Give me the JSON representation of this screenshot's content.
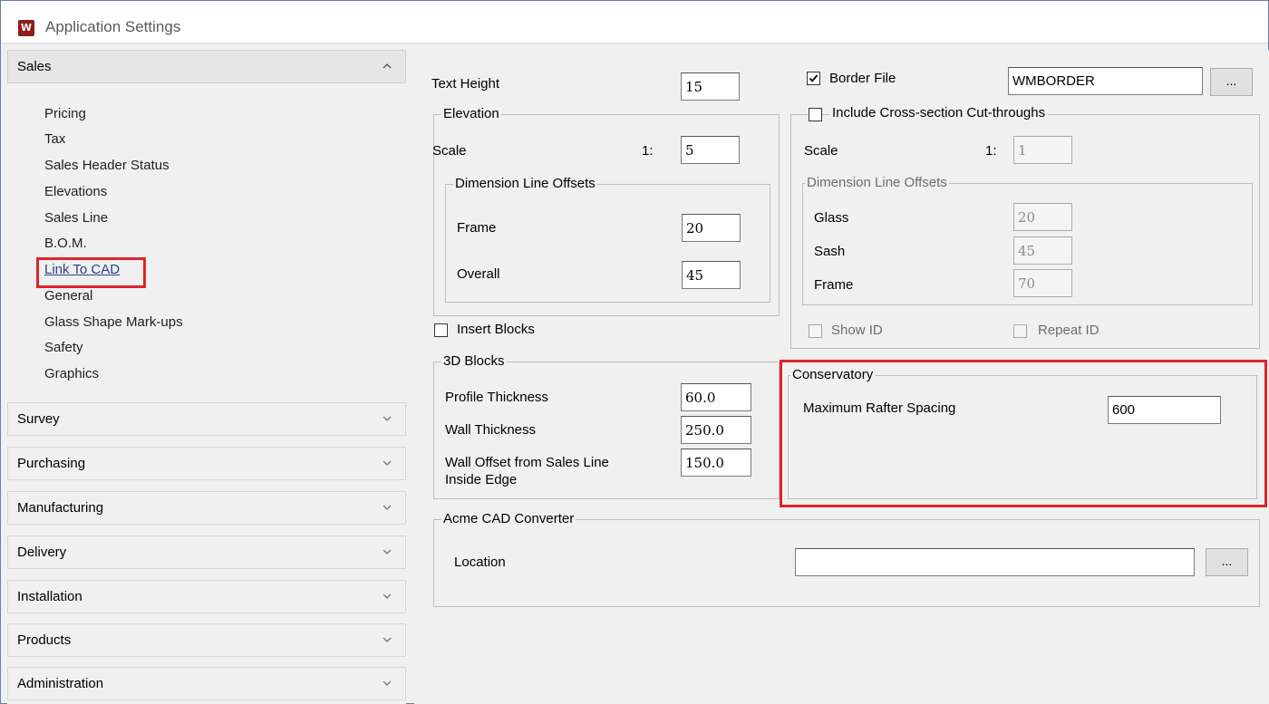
{
  "window": {
    "title": "Application Settings",
    "logo_letter": "W",
    "highlight_color": "#e0242a"
  },
  "sidebar": {
    "groups": [
      {
        "label": "Sales",
        "expanded": true,
        "icon": "chevron-up-icon"
      },
      {
        "label": "Survey",
        "expanded": false,
        "icon": "chevron-down-icon"
      },
      {
        "label": "Purchasing",
        "expanded": false,
        "icon": "chevron-down-icon"
      },
      {
        "label": "Manufacturing",
        "expanded": false,
        "icon": "chevron-down-icon"
      },
      {
        "label": "Delivery",
        "expanded": false,
        "icon": "chevron-down-icon"
      },
      {
        "label": "Installation",
        "expanded": false,
        "icon": "chevron-down-icon"
      },
      {
        "label": "Products",
        "expanded": false,
        "icon": "chevron-down-icon"
      },
      {
        "label": "Administration",
        "expanded": false,
        "icon": "chevron-down-icon"
      }
    ],
    "sales_items": [
      "Pricing",
      "Tax",
      "Sales Header Status",
      "Elevations",
      "Sales Line",
      "B.O.M.",
      "Link To CAD",
      "General",
      "Glass Shape Mark-ups",
      "Safety",
      "Graphics"
    ],
    "selected_item": "Link To CAD"
  },
  "main": {
    "text_height": {
      "label": "Text Height",
      "value": "15"
    },
    "elevation": {
      "legend": "Elevation",
      "scale_label": "Scale",
      "scale_prefix": "1:",
      "scale_value": "5",
      "dim_offsets": {
        "legend": "Dimension Line Offsets",
        "frame_label": "Frame",
        "frame_value": "20",
        "overall_label": "Overall",
        "overall_value": "45"
      }
    },
    "insert_blocks": {
      "label": "Insert Blocks",
      "checked": false
    },
    "blocks_3d": {
      "legend": "3D Blocks",
      "profile_label": "Profile Thickness",
      "profile_value": "60.0",
      "wall_label": "Wall Thickness",
      "wall_value": "250.0",
      "offset_label_1": "Wall Offset from Sales Line",
      "offset_label_2": "Inside Edge",
      "offset_value": "150.0"
    },
    "border_file": {
      "label": "Border File",
      "checked": true,
      "value": "WMBORDER",
      "browse_label": "..."
    },
    "cross_section": {
      "label": "Include Cross-section Cut-throughs",
      "checked": false,
      "scale_label": "Scale",
      "scale_prefix": "1:",
      "scale_value": "1",
      "dim_offsets": {
        "legend": "Dimension Line Offsets",
        "glass_label": "Glass",
        "glass_value": "20",
        "sash_label": "Sash",
        "sash_value": "45",
        "frame_label": "Frame",
        "frame_value": "70"
      },
      "show_id_label": "Show ID",
      "repeat_id_label": "Repeat ID"
    },
    "conservatory": {
      "legend": "Conservatory",
      "rafter_label": "Maximum Rafter Spacing",
      "rafter_value": "600"
    },
    "acme": {
      "legend": "Acme CAD Converter",
      "location_label": "Location",
      "location_value": "",
      "browse_label": "..."
    }
  }
}
